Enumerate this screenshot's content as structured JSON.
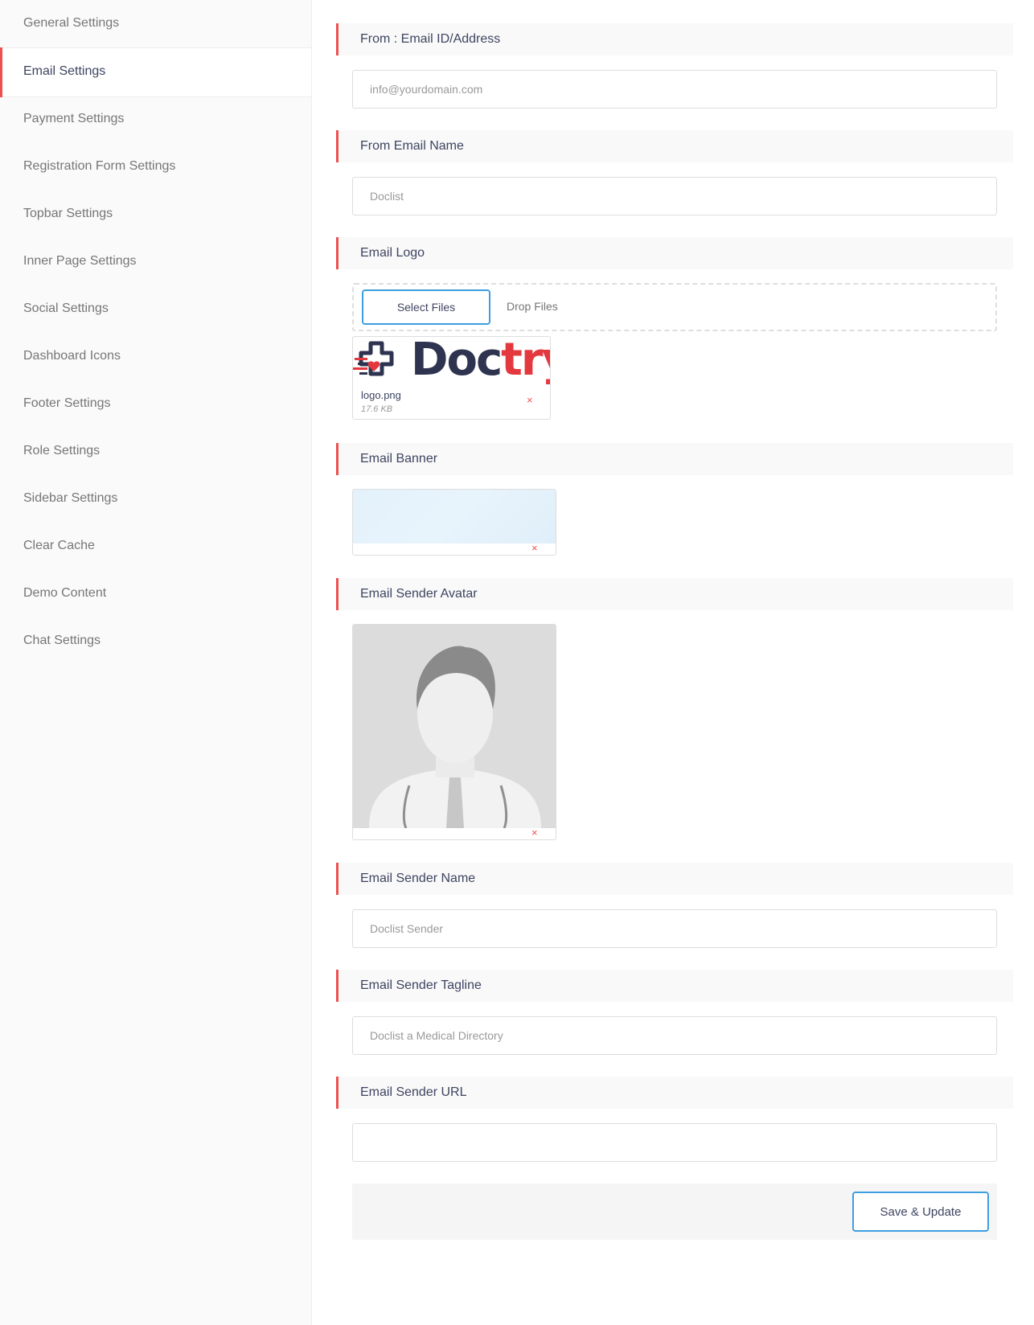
{
  "sidebar": {
    "items": [
      {
        "label": "General Settings"
      },
      {
        "label": "Email Settings",
        "active": true
      },
      {
        "label": "Payment Settings"
      },
      {
        "label": "Registration Form Settings"
      },
      {
        "label": "Topbar Settings"
      },
      {
        "label": "Inner Page Settings"
      },
      {
        "label": "Social Settings"
      },
      {
        "label": "Dashboard Icons"
      },
      {
        "label": "Footer Settings"
      },
      {
        "label": "Role Settings"
      },
      {
        "label": "Sidebar Settings"
      },
      {
        "label": "Clear Cache"
      },
      {
        "label": "Demo Content"
      },
      {
        "label": "Chat Settings"
      }
    ]
  },
  "form": {
    "from_email": {
      "title": "From : Email ID/Address",
      "placeholder": "info@yourdomain.com",
      "value": ""
    },
    "from_name": {
      "title": "From Email Name",
      "placeholder": "Doclist",
      "value": ""
    },
    "email_logo": {
      "title": "Email Logo",
      "select_label": "Select Files",
      "drop_label": "Drop Files",
      "file": {
        "name": "logo.png",
        "size": "17.6 KB",
        "brand_part1": "Doc",
        "brand_part2": "try"
      }
    },
    "email_banner": {
      "title": "Email Banner"
    },
    "email_avatar": {
      "title": "Email Sender Avatar"
    },
    "sender_name": {
      "title": "Email Sender Name",
      "placeholder": "Doclist Sender",
      "value": ""
    },
    "sender_tagline": {
      "title": "Email Sender Tagline",
      "placeholder": "Doclist a Medical Directory",
      "value": ""
    },
    "sender_url": {
      "title": "Email Sender URL",
      "placeholder": "",
      "value": ""
    },
    "save_label": "Save & Update",
    "remove_glyph": "×"
  },
  "colors": {
    "accent": "#ee4f4f",
    "button_border": "#3d9ee0",
    "text": "#3d4461",
    "muted": "#767676"
  },
  "icons": [
    "medical-cross-logo-icon",
    "remove-icon",
    "doctor-avatar-image"
  ]
}
